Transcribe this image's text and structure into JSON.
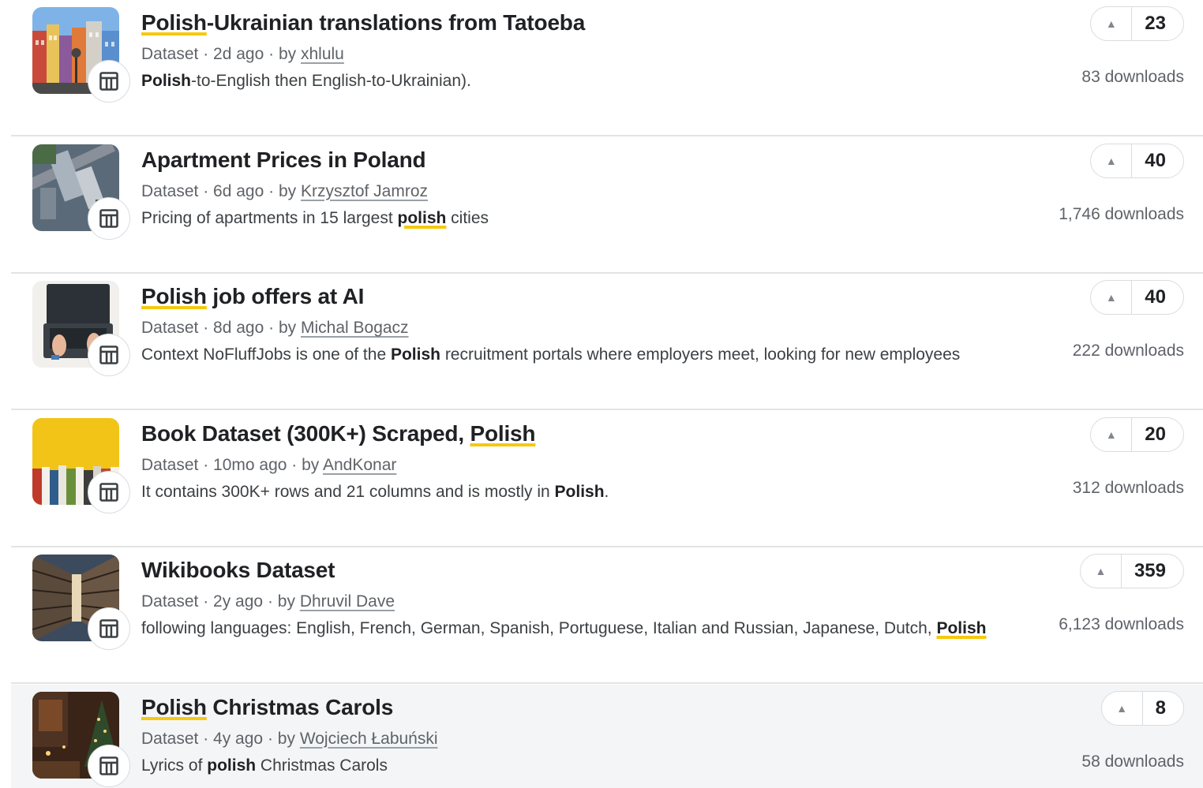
{
  "results": [
    {
      "title": [
        {
          "t": "Polish",
          "hl": true
        },
        {
          "t": "-Ukrainian translations from Tatoeba"
        }
      ],
      "type": "Dataset",
      "age": "2d ago",
      "by": "by",
      "author": "xhlulu",
      "snippet": [
        {
          "t": "Polish",
          "b": true
        },
        {
          "t": "-to-English then English-to-Ukrainian)."
        }
      ],
      "votes": "23",
      "downloads": "83 downloads",
      "thumb": "city-street-thumbnail"
    },
    {
      "title": [
        {
          "t": "Apartment Prices in Poland"
        }
      ],
      "type": "Dataset",
      "age": "6d ago",
      "by": "by",
      "author": "Krzysztof Jamroz",
      "snippet": [
        {
          "t": "Pricing of apartments in 15 largest "
        },
        {
          "t": "polish",
          "b": true,
          "hl": true
        },
        {
          "t": " cities"
        }
      ],
      "votes": "40",
      "downloads": "1,746 downloads",
      "thumb": "aerial-city-thumbnail"
    },
    {
      "title": [
        {
          "t": "Polish",
          "hl": true
        },
        {
          "t": " job offers at AI"
        }
      ],
      "type": "Dataset",
      "age": "8d ago",
      "by": "by",
      "author": "Michal Bogacz",
      "snippet": [
        {
          "t": "Context NoFluffJobs is one of the "
        },
        {
          "t": "Polish",
          "b": true
        },
        {
          "t": " recruitment portals where employers meet, looking for new employees"
        }
      ],
      "votes": "40",
      "downloads": "222 downloads",
      "thumb": "laptop-hands-thumbnail"
    },
    {
      "title": [
        {
          "t": "Book Dataset (300K+) Scraped, "
        },
        {
          "t": "Polish",
          "hl": true
        }
      ],
      "type": "Dataset",
      "age": "10mo ago",
      "by": "by",
      "author": "AndKonar",
      "snippet": [
        {
          "t": "It contains 300K+ rows and 21 columns and is mostly in "
        },
        {
          "t": "Polish",
          "b": true
        },
        {
          "t": "."
        }
      ],
      "votes": "20",
      "downloads": "312 downloads",
      "thumb": "books-yellow-thumbnail"
    },
    {
      "title": [
        {
          "t": "Wikibooks Dataset"
        }
      ],
      "type": "Dataset",
      "age": "2y ago",
      "by": "by",
      "author": "Dhruvil Dave",
      "snippet": [
        {
          "t": "following languages: English, French, German, Spanish, Portuguese, Italian and Russian, Japanese, Dutch, "
        },
        {
          "t": "Polish",
          "b": true,
          "hl": true
        }
      ],
      "votes": "359",
      "downloads": "6,123 downloads",
      "thumb": "library-thumbnail"
    },
    {
      "title": [
        {
          "t": "Polish",
          "hl": true
        },
        {
          "t": " Christmas Carols"
        }
      ],
      "type": "Dataset",
      "age": "4y ago",
      "by": "by",
      "author": "Wojciech Łabuński",
      "snippet": [
        {
          "t": "Lyrics of "
        },
        {
          "t": "polish",
          "b": true
        },
        {
          "t": " Christmas Carols"
        }
      ],
      "votes": "8",
      "downloads": "58 downloads",
      "thumb": "christmas-room-thumbnail",
      "hovered": true
    }
  ],
  "icons": {
    "type_badge": "table-icon",
    "upvote": "upvote-arrow-icon"
  },
  "colors": {
    "highlight": "#f6c90e",
    "divider": "#e3e3e3",
    "hover_bg": "#f3f5f7"
  }
}
